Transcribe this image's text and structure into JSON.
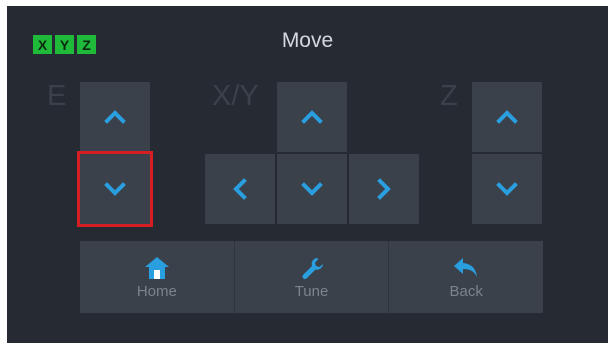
{
  "header": {
    "title": "Move",
    "axis_badges": [
      "X",
      "Y",
      "Z"
    ],
    "badge_color": "#1fba3a"
  },
  "groups": {
    "e": {
      "label": "E"
    },
    "xy": {
      "label": "X/Y"
    },
    "z": {
      "label": "Z"
    }
  },
  "bottom_bar": {
    "home_label": "Home",
    "tune_label": "Tune",
    "back_label": "Back"
  },
  "colors": {
    "background": "#262b33",
    "button": "#3a414b",
    "accent": "#2a9fe0",
    "selection": "#d51f25"
  },
  "icons": {
    "up": "chevron-up-icon",
    "down": "chevron-down-icon",
    "left": "chevron-left-icon",
    "right": "chevron-right-icon",
    "home": "home-icon",
    "tune": "wrench-icon",
    "back": "back-arrow-icon"
  }
}
